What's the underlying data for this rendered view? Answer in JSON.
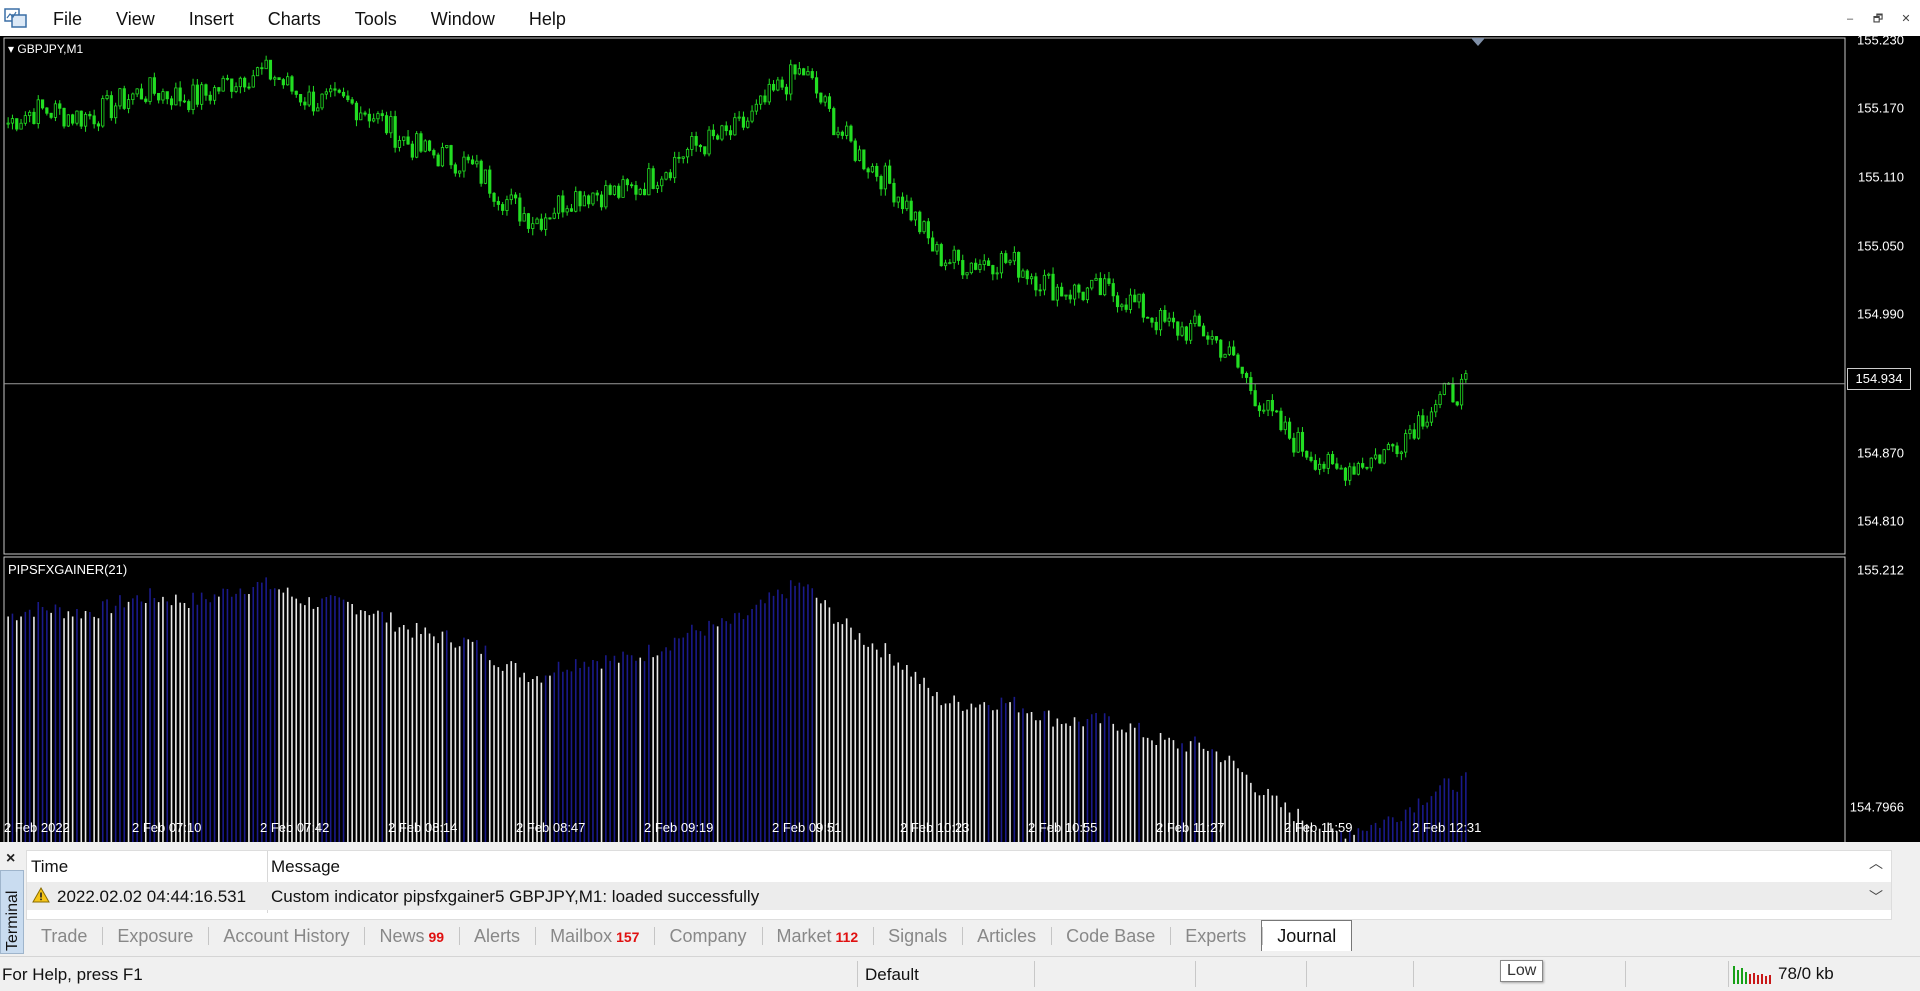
{
  "menu": {
    "items": [
      "File",
      "View",
      "Insert",
      "Charts",
      "Tools",
      "Window",
      "Help"
    ]
  },
  "window_controls": {
    "minimize": "–",
    "restore": "🗗",
    "close": "✕"
  },
  "chart": {
    "symbol_label": "GBPJPY,M1",
    "indicator_label": "PIPSFXGAINER(21)",
    "price_scale": [
      "155.230",
      "155.170",
      "155.110",
      "155.050",
      "154.990",
      "154.870",
      "154.810"
    ],
    "current_price": "154.934",
    "indicator_scale": [
      "155.212",
      "154.7966"
    ],
    "time_axis": [
      "2 Feb 2022",
      "2 Feb 07:10",
      "2 Feb 07:42",
      "2 Feb 08:14",
      "2 Feb 08:47",
      "2 Feb 09:19",
      "2 Feb 09:51",
      "2 Feb 10:23",
      "2 Feb 10:55",
      "2 Feb 11:27",
      "2 Feb 11:59",
      "2 Feb 12:31"
    ],
    "colors": {
      "candle": "#22dd22",
      "indicator_up": "#1a1a8a",
      "indicator_down": "#e8e8e8",
      "background": "#000000"
    }
  },
  "chart_data": {
    "type": "line",
    "title": "GBPJPY,M1",
    "ylim": [
      154.79,
      155.23
    ],
    "x": [
      "2 Feb 2022",
      "2 Feb 07:10",
      "2 Feb 07:42",
      "2 Feb 08:14",
      "2 Feb 08:47",
      "2 Feb 09:19",
      "2 Feb 09:51",
      "2 Feb 10:23",
      "2 Feb 10:55",
      "2 Feb 11:27",
      "2 Feb 11:59",
      "2 Feb 12:31"
    ],
    "series": [
      {
        "values": [
          155.16,
          155.18,
          155.2,
          155.15,
          155.08,
          155.12,
          155.2,
          155.05,
          155.02,
          154.98,
          154.85,
          154.93
        ]
      }
    ]
  },
  "terminal": {
    "side_label": "Terminal",
    "close": "×",
    "columns": [
      "Time",
      "Message"
    ],
    "rows": [
      {
        "time": "2022.02.02 04:44:16.531",
        "message": "Custom indicator pipsfxgainer5 GBPJPY,M1: loaded successfully"
      }
    ],
    "tabs": [
      {
        "label": "Trade",
        "badge": ""
      },
      {
        "label": "Exposure",
        "badge": ""
      },
      {
        "label": "Account History",
        "badge": ""
      },
      {
        "label": "News",
        "badge": "99"
      },
      {
        "label": "Alerts",
        "badge": ""
      },
      {
        "label": "Mailbox",
        "badge": "157"
      },
      {
        "label": "Company",
        "badge": ""
      },
      {
        "label": "Market",
        "badge": "112"
      },
      {
        "label": "Signals",
        "badge": ""
      },
      {
        "label": "Articles",
        "badge": ""
      },
      {
        "label": "Code Base",
        "badge": ""
      },
      {
        "label": "Experts",
        "badge": ""
      },
      {
        "label": "Journal",
        "badge": ""
      }
    ],
    "active_tab": "Journal"
  },
  "status": {
    "help": "For Help, press F1",
    "profile": "Default",
    "tooltip": "Low",
    "connection": "78/0 kb"
  }
}
